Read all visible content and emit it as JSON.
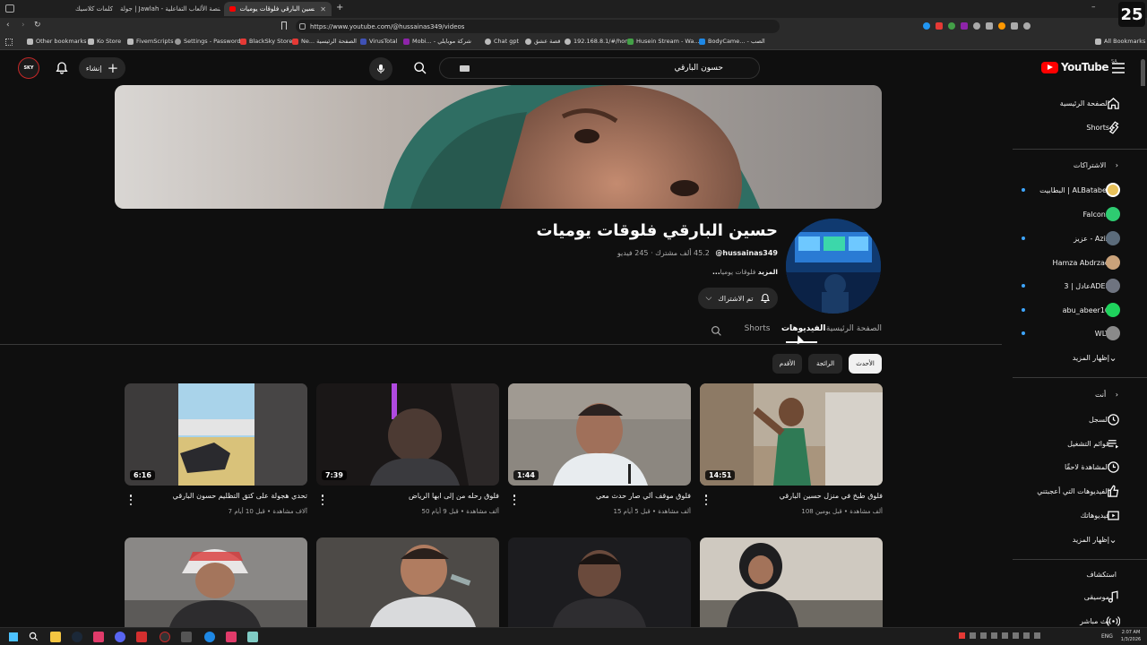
{
  "browser": {
    "tabs": [
      {
        "label": "كلمات كلاسيك",
        "active": false
      },
      {
        "label": "جولة | Jawlah - منصة الألعاب التفاعلية",
        "active": false
      },
      {
        "label": "حسين البارقي فلوقات يوميات - YouTube",
        "active": true
      }
    ],
    "url": "https://www.youtube.com/@hussainas349/videos",
    "bookmarks": [
      "Other bookmarks",
      "Ko Store",
      "FivemScripts",
      "Settings - Passwords",
      "BlackSky Store",
      "Ne... الصفحة الرئيسية",
      "VirusTotal",
      "Mobi... - شركة موبايلي",
      "Chat gpt",
      "قصة عشق",
      "192.168.8.1/#/home",
      "Husein Stream - Wa...",
      "BodyCame... - الصب"
    ],
    "all_bookmarks": "All Bookmarks",
    "clock_badge": "25"
  },
  "header": {
    "logo_text": "YouTube",
    "region": "SA",
    "search_value": "حسون البارقي",
    "create_label": "إنشاء",
    "avatar_text": "SKY"
  },
  "channel": {
    "name": "حسين البارقي فلوقات يوميات",
    "handle": "@hussainas349",
    "stats": "‏45.2 ألف مشترك ‏· 245 فيديو",
    "description": "فلوقات يوميا",
    "more": "...المزيد",
    "subscribed_label": "تم الاشتراك",
    "tabs": [
      "الصفحة الرئيسية",
      "الفيديوهات",
      "Shorts"
    ],
    "active_tab": "الفيديوهات",
    "chips": [
      "الأحدث",
      "الرائجة",
      "الأقدم"
    ]
  },
  "videos": [
    {
      "title": "فلوق طبخ في منزل حسين البارقي",
      "meta": "108 ألف مشاهدة • قبل يومين",
      "duration": "14:51"
    },
    {
      "title": "فلوق موقف ألي صار حدث معي",
      "meta": "15 ألف مشاهدة • قبل 5 أيام",
      "duration": "1:44"
    },
    {
      "title": "فلوق رحله من إلى ابها الرياض",
      "meta": "50 ألف مشاهدة • قبل 9 أيام",
      "duration": "7:39"
    },
    {
      "title": "تحدي هجولة على كتق التظليم حسون البارقي",
      "meta": "7 آلاف مشاهدة • قبل 10 أيام",
      "duration": "6:16"
    }
  ],
  "sidebar": {
    "main": [
      {
        "label": "الصفحة الرئيسية",
        "icon": "home-icon"
      },
      {
        "label": "Shorts",
        "icon": "shorts-icon"
      }
    ],
    "subscriptions_header": "الاشتراكات",
    "subscriptions": [
      {
        "label": "البطابيت | ALBatabet",
        "dot": true,
        "color": "#e8c15a"
      },
      {
        "label": "Falcons",
        "dot": false,
        "color": "#2ecc71"
      },
      {
        "label": "عزيز - Aziz",
        "dot": true,
        "color": "#5b6b7a"
      },
      {
        "label": "Hamza Abdrzaq",
        "dot": false,
        "color": "#caa27a"
      },
      {
        "label": "عادل | 3ADEL",
        "dot": true,
        "color": "#6f7480"
      },
      {
        "label": "abu_abeer16",
        "dot": true,
        "color": "#1fd35d"
      },
      {
        "label": "WLY",
        "dot": true,
        "color": "#8a8a8a"
      }
    ],
    "show_more": "إظهار المزيد",
    "you_header": "أنت",
    "you_items": [
      {
        "label": "السجل",
        "icon": "history-icon"
      },
      {
        "label": "قوائم التشغيل",
        "icon": "playlists-icon"
      },
      {
        "label": "المشاهدة لاحقًا",
        "icon": "watch-later-icon"
      },
      {
        "label": "الفيديوهات التي أعجبتني",
        "icon": "liked-icon"
      },
      {
        "label": "فيديوهاتك",
        "icon": "your-videos-icon"
      }
    ],
    "show_more_2": "إظهار المزيد",
    "explore_header": "استكشاف",
    "explore_items": [
      {
        "label": "موسيقى",
        "icon": "music-icon"
      },
      {
        "label": "بث مباشر",
        "icon": "live-icon"
      }
    ]
  },
  "taskbar": {
    "lang": "ENG",
    "time": "2:07 AM",
    "date": "1/3/2026"
  },
  "colors": {
    "accent": "#3ea6ff",
    "youtube_red": "#ff0000",
    "bg": "#0f0f0f"
  }
}
